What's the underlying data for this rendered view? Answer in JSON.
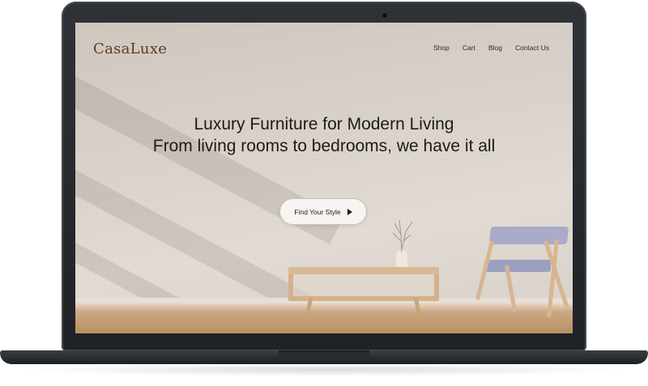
{
  "site": {
    "logo": "CasaLuxe"
  },
  "nav": {
    "items": [
      "Shop",
      "Cart",
      "Blog",
      "Contact Us"
    ]
  },
  "hero": {
    "headline": "Luxury Furniture for Modern Living",
    "subheadline": "From living rooms to bedrooms, we have it all",
    "cta_label": "Find Your Style",
    "cta_icon": "play-arrow-icon"
  },
  "colors": {
    "logo": "#5b3a22",
    "background": "#d8d1ca",
    "wood": "#caa883",
    "chair_fabric": "#a9abc7",
    "device_frame": "#2a2d31"
  }
}
